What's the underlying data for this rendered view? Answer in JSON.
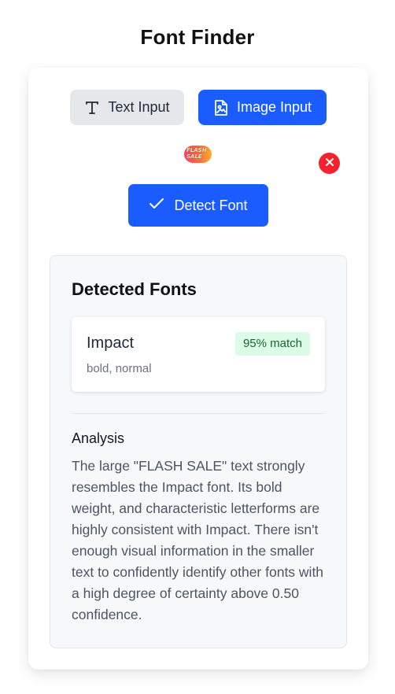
{
  "app": {
    "title": "Font Finder"
  },
  "modes": {
    "text_label": "Text Input",
    "image_label": "Image Input",
    "active": "image"
  },
  "upload": {
    "thumbnail_text": "FLASH\nSALE"
  },
  "actions": {
    "detect_label": "Detect Font"
  },
  "results": {
    "title": "Detected Fonts",
    "fonts": [
      {
        "name": "Impact",
        "styles": "bold, normal",
        "match": "95% match"
      }
    ],
    "analysis_label": "Analysis",
    "analysis_text": "The large \"FLASH SALE\" text strongly resembles the Impact font. Its bold weight, and characteristic letterforms are highly consistent with Impact. There isn't enough visual information in the smaller text to confidently identify other fonts with a high degree of certainty above 0.50 confidence."
  },
  "colors": {
    "primary": "#1a5cff",
    "secondary_bg": "#e5e7eb",
    "danger": "#f5222d",
    "match_bg": "#dcfce7",
    "match_text": "#166534"
  },
  "icons": {
    "text_mode": "text-type-icon",
    "image_mode": "image-file-icon",
    "remove": "close-icon",
    "detect": "checkmark-icon"
  }
}
